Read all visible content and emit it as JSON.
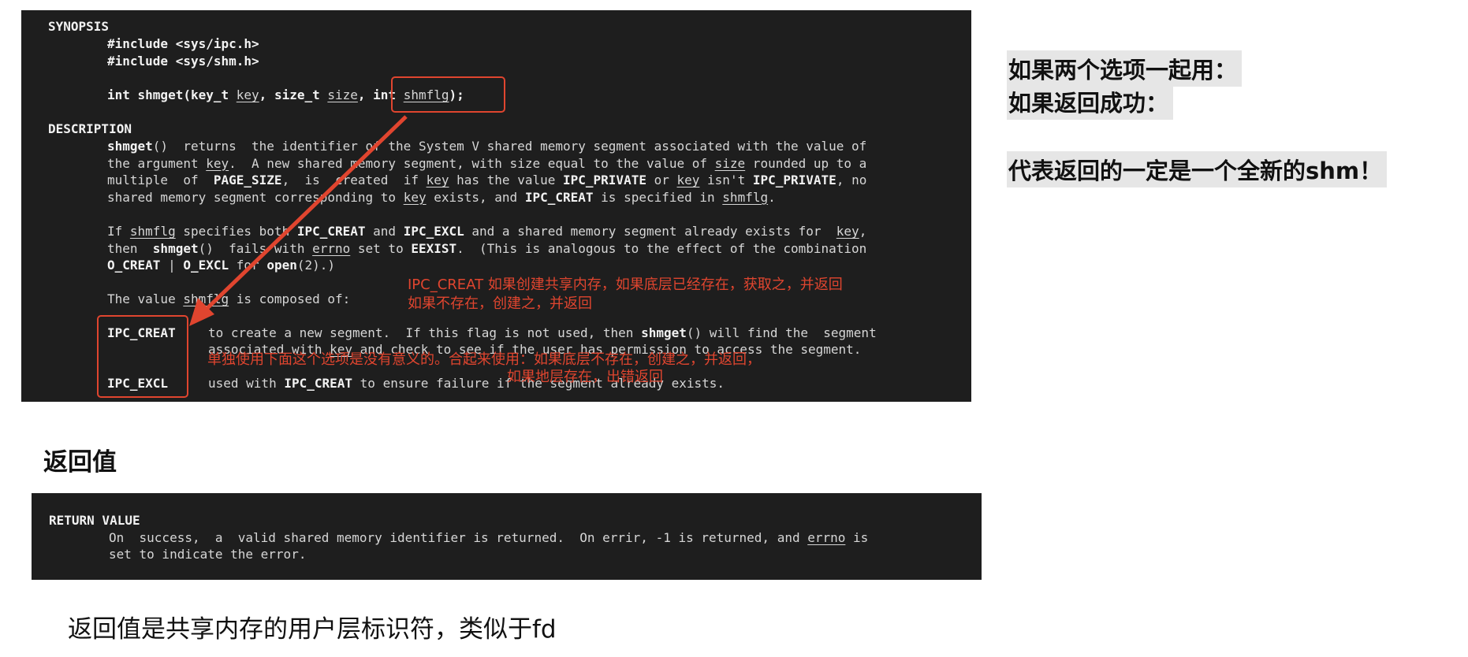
{
  "synopsis": {
    "header": "SYNOPSIS",
    "include1": "#include <sys/ipc.h>",
    "include2": "#include <sys/shm.h>",
    "proto_a": "int shmget(key_t ",
    "proto_key": "key",
    "proto_b": ", size_t ",
    "proto_size": "size",
    "proto_c": ", int ",
    "proto_shmflg": "shmflg",
    "proto_d": ");"
  },
  "description": {
    "header": "DESCRIPTION",
    "p1": [
      {
        "segments": [
          {
            "text": "shmget",
            "style": "b"
          },
          {
            "text": "()  returns  the identifier of the System V shared memory segment associated with the value of",
            "style": ""
          }
        ]
      },
      {
        "segments": [
          {
            "text": "the argument ",
            "style": ""
          },
          {
            "text": "key",
            "style": "u"
          },
          {
            "text": ".  A new shared memory segment, with size equal to the value of ",
            "style": ""
          },
          {
            "text": "size",
            "style": "u"
          },
          {
            "text": " rounded up to a",
            "style": ""
          }
        ]
      },
      {
        "segments": [
          {
            "text": "multiple  of  ",
            "style": ""
          },
          {
            "text": "PAGE_SIZE",
            "style": "b"
          },
          {
            "text": ",  is  created  if ",
            "style": ""
          },
          {
            "text": "key",
            "style": "u"
          },
          {
            "text": " has the value ",
            "style": ""
          },
          {
            "text": "IPC_PRIVATE",
            "style": "b"
          },
          {
            "text": " or ",
            "style": ""
          },
          {
            "text": "key",
            "style": "u"
          },
          {
            "text": " isn't ",
            "style": ""
          },
          {
            "text": "IPC_PRIVATE",
            "style": "b"
          },
          {
            "text": ", no",
            "style": ""
          }
        ]
      },
      {
        "segments": [
          {
            "text": "shared memory segment corresponding to ",
            "style": ""
          },
          {
            "text": "key",
            "style": "u"
          },
          {
            "text": " exists, and ",
            "style": ""
          },
          {
            "text": "IPC_CREAT",
            "style": "b"
          },
          {
            "text": " is specified in ",
            "style": ""
          },
          {
            "text": "shmflg",
            "style": "u"
          },
          {
            "text": ".",
            "style": ""
          }
        ]
      }
    ],
    "p2": [
      {
        "segments": [
          {
            "text": "If ",
            "style": ""
          },
          {
            "text": "shmflg",
            "style": "u"
          },
          {
            "text": " specifies both ",
            "style": ""
          },
          {
            "text": "IPC_CREAT",
            "style": "b"
          },
          {
            "text": " and ",
            "style": ""
          },
          {
            "text": "IPC_EXCL",
            "style": "b"
          },
          {
            "text": " and a shared memory segment already exists for  ",
            "style": ""
          },
          {
            "text": "key",
            "style": "u"
          },
          {
            "text": ",",
            "style": ""
          }
        ]
      },
      {
        "segments": [
          {
            "text": "then  ",
            "style": ""
          },
          {
            "text": "shmget",
            "style": "b"
          },
          {
            "text": "()  fails with ",
            "style": ""
          },
          {
            "text": "errno",
            "style": "u"
          },
          {
            "text": " set to ",
            "style": ""
          },
          {
            "text": "EEXIST",
            "style": "b"
          },
          {
            "text": ".  (This is analogous to the effect of the combination",
            "style": ""
          }
        ]
      },
      {
        "segments": [
          {
            "text": "O_CREAT",
            "style": "b"
          },
          {
            "text": " | ",
            "style": ""
          },
          {
            "text": "O_EXCL",
            "style": "b"
          },
          {
            "text": " for ",
            "style": ""
          },
          {
            "text": "open",
            "style": "b"
          },
          {
            "text": "(2).)",
            "style": ""
          }
        ]
      }
    ],
    "value_line_a": "The value ",
    "value_line_shmflg": "shmflg",
    "value_line_b": " is composed of:",
    "ipc_creat_label": "IPC_CREAT",
    "ipc_creat_desc_1a": "to create a new segment.  If this flag is not used, then ",
    "ipc_creat_desc_1b": "shmget",
    "ipc_creat_desc_1c": "() will find the  segment",
    "ipc_creat_desc_2a": "associated with ",
    "ipc_creat_desc_2b": "key",
    "ipc_creat_desc_2c": " and check to see if the user has permission to access the segment.",
    "ipc_excl_label": "IPC_EXCL",
    "ipc_excl_desc_a": "used with ",
    "ipc_excl_desc_b": "IPC_CREAT",
    "ipc_excl_desc_c": " to ensure failure if the segment already exists."
  },
  "annotations": {
    "creat_note_1": "IPC_CREAT 如果创建共享内存，如果底层已经存在，获取之，并返回",
    "creat_note_2": "如果不存在，创建之，并返回",
    "excl_note_1": "单独使用下面这个选项是没有意义的。合起来使用：如果底层不存在，创建之，并返回，",
    "excl_note_2": "如果地层存在，出错返回"
  },
  "return_section": {
    "heading": "返回值",
    "header": "RETURN VALUE",
    "line1_a": "On  success,  a  valid shared memory identifier is returned.  On errir, -1 is returned, and ",
    "line1_errno": "errno",
    "line1_b": " is",
    "line2": "set to indicate the error.",
    "note": "返回值是共享内存的用户层标识符，类似于fd"
  },
  "side_notes": {
    "line1": "如果两个选项一起用：",
    "line2": "如果返回成功：",
    "line3": "代表返回的一定是一个全新的shm！"
  },
  "colors": {
    "terminal_bg": "#1e1e1e",
    "annotation_red": "#e0452f",
    "highlight_bg": "#e6e6e6"
  }
}
